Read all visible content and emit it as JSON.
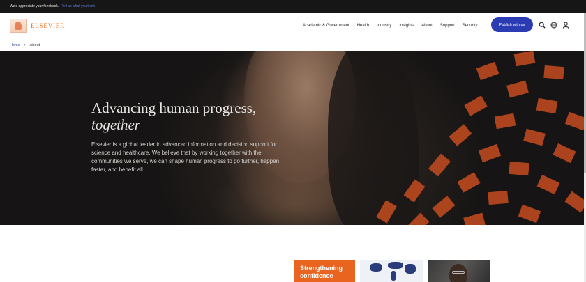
{
  "banner": {
    "text": "We'd appreciate your feedback.",
    "link": "Tell us what you think"
  },
  "header": {
    "logo_text": "ELSEVIER",
    "nav": [
      "Academic & Government",
      "Health",
      "Industry",
      "Insights",
      "About",
      "Support",
      "Security"
    ],
    "publish_label": "Publish with us",
    "icons": [
      "search-icon",
      "globe-icon",
      "user-icon"
    ]
  },
  "breadcrumb": {
    "home": "Home",
    "separator": "›",
    "current": "About"
  },
  "hero": {
    "title_line1": "Advancing human progress,",
    "title_line2": "together",
    "text": "Elsevier is a global leader in advanced information and decision support for science and healthcare. We believe that by working together with the communities we serve, we can shape human progress to go further, happen faster, and benefit all."
  },
  "cards": {
    "first_title_line1": "Strengthening",
    "first_title_line2": "confidence"
  },
  "colors": {
    "brand_orange": "#e9711c",
    "publish_blue": "#2b3bb3",
    "tile_orange": "#b8491f"
  }
}
